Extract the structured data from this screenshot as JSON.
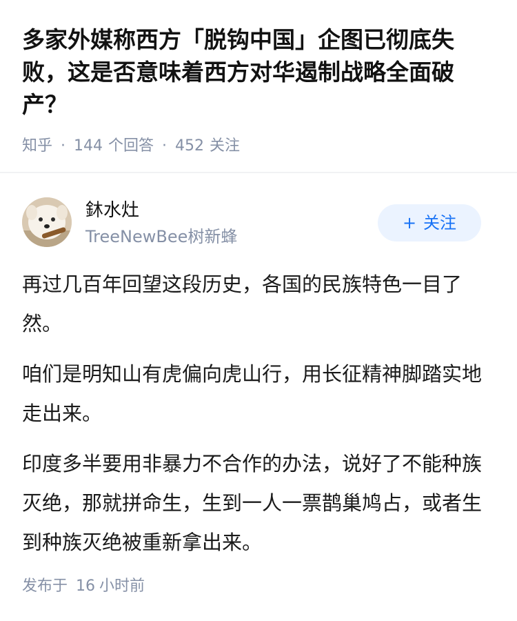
{
  "question": {
    "title": "多家外媒称西方「脱钩中国」企图已彻底失败，这是否意味着西方对华遏制战略全面破产？",
    "source": "知乎",
    "answers_count": "144",
    "answers_label": "个回答",
    "followers_count": "452",
    "followers_label": "关注"
  },
  "author": {
    "name": "鈢水灶",
    "bio": "TreeNewBee树新蜂",
    "avatar_icon": "dog-avatar-icon",
    "follow_label": "关注",
    "follow_icon": "plus-icon"
  },
  "answer": {
    "paragraphs": [
      "再过几百年回望这段历史，各国的民族特色一目了然。",
      "咱们是明知山有虎偏向虎山行，用长征精神脚踏实地走出来。",
      "印度多半要用非暴力不合作的办法，说好了不能种族灭绝，那就拼命生，生到一人一票鹊巢鸠占，或者生到种族灭绝被重新拿出来。"
    ],
    "published_label": "发布于",
    "published_value": "16",
    "published_unit": "小时前"
  },
  "colors": {
    "meta_gray": "#8590a6",
    "follow_blue": "#1772f6",
    "follow_bg": "#ebf3ff"
  }
}
